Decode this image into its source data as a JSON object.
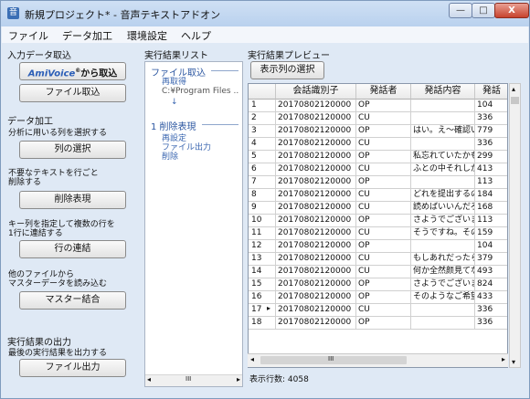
{
  "window": {
    "app_icon": "app-icon",
    "title": "新規プロジェクト* - 音声テキストアドオン",
    "minimize_glyph": "—",
    "maximize_glyph": "□",
    "close_glyph": "X"
  },
  "menu": [
    "ファイル",
    "データ加工",
    "環境設定",
    "ヘルプ"
  ],
  "left_panel": {
    "input_header": "入力データ取込",
    "amivoice_logo": "AmiVoice",
    "amivoice_reg": "®",
    "amivoice_suffix": "から取込",
    "file_import_button": "ファイル取込",
    "data_processing_header": "データ加工",
    "select_columns_desc": "分析に用いる列を選択する",
    "select_columns_button": "列の選択",
    "delete_desc_line1": "不要なテキストを行ごと",
    "delete_desc_line2": "削除する",
    "delete_button": "削除表現",
    "concat_desc_line1": "キー列を指定して複数の行を",
    "concat_desc_line2": "1行に連結する",
    "concat_button": "行の連結",
    "master_desc_line1": "他のファイルから",
    "master_desc_line2": "マスターデータを読み込む",
    "master_button": "マスター結合",
    "output_header": "実行結果の出力",
    "output_desc": "最後の実行結果を出力する",
    "output_button": "ファイル出力"
  },
  "results_list": {
    "header": "実行結果リスト",
    "node1_title": "ファイル取込",
    "node1_sub1": "再取得",
    "node1_sub2": "C:¥Program Files ..",
    "arrow": "↓",
    "node2_title": "1 削除表現",
    "node2_sub1": "再設定",
    "node2_sub2": "ファイル出力",
    "node2_sub3": "削除",
    "scroll_left": "◂",
    "scroll_mid": "III",
    "scroll_right": "▸"
  },
  "preview": {
    "header": "実行結果プレビュー",
    "select_display_button": "表示列の選択",
    "columns": [
      "会話識別子",
      "発話者",
      "発話内容",
      "発話"
    ],
    "rows": [
      {
        "n": "1",
        "id": "20170802120000",
        "speaker": "OP",
        "content": "",
        "num": "104"
      },
      {
        "n": "2",
        "id": "20170802120000",
        "speaker": "CU",
        "content": "",
        "num": "336"
      },
      {
        "n": "3",
        "id": "20170802120000",
        "speaker": "OP",
        "content": "はい。え～確認い",
        "num": "779"
      },
      {
        "n": "4",
        "id": "20170802120000",
        "speaker": "CU",
        "content": "",
        "num": "336"
      },
      {
        "n": "5",
        "id": "20170802120000",
        "speaker": "OP",
        "content": "私忘れていたかも",
        "num": "299"
      },
      {
        "n": "6",
        "id": "20170802120000",
        "speaker": "CU",
        "content": "ふとの中それしか入",
        "num": "413"
      },
      {
        "n": "7",
        "id": "20170802120000",
        "speaker": "OP",
        "content": "",
        "num": "113"
      },
      {
        "n": "8",
        "id": "20170802120000",
        "speaker": "CU",
        "content": "どれを提出するの",
        "num": "184"
      },
      {
        "n": "9",
        "id": "20170802120000",
        "speaker": "CU",
        "content": "読めばいいんだろう",
        "num": "168"
      },
      {
        "n": "10",
        "id": "20170802120000",
        "speaker": "OP",
        "content": "さようでございます",
        "num": "113"
      },
      {
        "n": "11",
        "id": "20170802120000",
        "speaker": "CU",
        "content": "そうですね。その方",
        "num": "159"
      },
      {
        "n": "12",
        "id": "20170802120000",
        "speaker": "OP",
        "content": "",
        "num": "104"
      },
      {
        "n": "13",
        "id": "20170802120000",
        "speaker": "CU",
        "content": "もしあれだったら担",
        "num": "379"
      },
      {
        "n": "14",
        "id": "20170802120000",
        "speaker": "CU",
        "content": "何か全然颜見てな",
        "num": "493"
      },
      {
        "n": "15",
        "id": "20170802120000",
        "speaker": "OP",
        "content": "さようでございます",
        "num": "824"
      },
      {
        "n": "16",
        "id": "20170802120000",
        "speaker": "OP",
        "content": "そのようなご希望が",
        "num": "433"
      },
      {
        "n": "17",
        "id": "20170802120000",
        "speaker": "CU",
        "content": "",
        "num": "336"
      },
      {
        "n": "18",
        "id": "20170802120000",
        "speaker": "OP",
        "content": "",
        "num": "336"
      }
    ],
    "current_row_marker": "▸",
    "row_count_label": "表示行数: 4058",
    "vscroll_up": "▴",
    "vscroll_down": "▾",
    "hscroll_left": "◂",
    "hscroll_mid": "III",
    "hscroll_right": "▸"
  }
}
